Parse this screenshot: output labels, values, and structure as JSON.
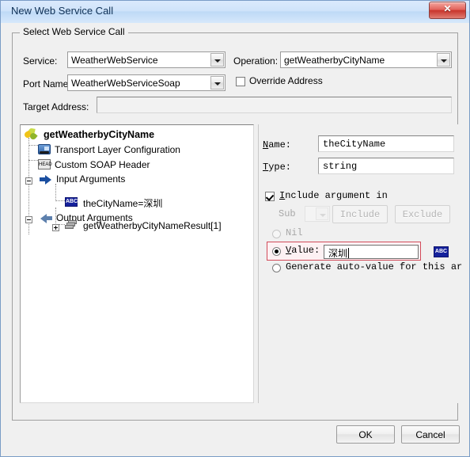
{
  "window": {
    "title": "New Web Service Call",
    "close_label": "✕",
    "close_icon": "close-icon"
  },
  "groupbox": {
    "title": "Select Web Service Call"
  },
  "form": {
    "service_label": "Service:",
    "service_value": "WeatherWebService",
    "operation_label": "Operation:",
    "operation_value": "getWeatherbyCityName",
    "port_name_label": "Port Name:",
    "port_name_value": "WeatherWebServiceSoap",
    "override_address_label": "Override Address",
    "override_address_checked": false,
    "target_address_label": "Target Address:",
    "target_address_value": "",
    "target_address_enabled": false
  },
  "tree": {
    "nodes": [
      {
        "label": "getWeatherbyCityName",
        "icon": "service-leaf-icon",
        "level": 0,
        "expander": "none",
        "bold": true
      },
      {
        "label": "Transport Layer Configuration",
        "icon": "transport-truck-icon",
        "level": 1,
        "expander": "none",
        "bold": false
      },
      {
        "label": "Custom SOAP Header",
        "icon": "soap-header-icon",
        "level": 1,
        "expander": "none",
        "bold": false
      },
      {
        "label": "Input Arguments",
        "icon": "arrow-right-icon",
        "level": 1,
        "expander": "minus",
        "bold": false
      },
      {
        "label": "theCityName=深圳",
        "icon": "abc-string-icon",
        "level": 2,
        "expander": "none",
        "bold": false
      },
      {
        "label": "Output Arguments",
        "icon": "arrow-left-icon",
        "level": 1,
        "expander": "minus",
        "bold": false
      },
      {
        "label": "getWeatherbyCityNameResult[1]",
        "icon": "array-stack-icon",
        "level": 2,
        "expander": "plus",
        "bold": false
      }
    ]
  },
  "details": {
    "name_label": "Name:",
    "name_mnemonic": "N",
    "name_value": "theCityName",
    "type_label": "Type:",
    "type_mnemonic": "T",
    "type_value": "string",
    "include_label": "Include argument in",
    "include_mnemonic": "I",
    "include_checked": true,
    "sub_label": "Sub",
    "sub_value": "",
    "include_button": "Include",
    "exclude_button": "Exclude",
    "nil_label": "Nil",
    "nil_selected": false,
    "value_label": "Value:",
    "value_mnemonic": "V",
    "value_selected": true,
    "value_text": "深圳",
    "abc_button_label": "ABC",
    "generate_label": "Generate auto-value for this ar",
    "generate_selected": false
  },
  "footer": {
    "ok_label": "OK",
    "cancel_label": "Cancel"
  },
  "colors": {
    "title_bar": "#cfe3fa",
    "accent_red": "#d24b5a",
    "icon_blue": "#15219c",
    "dialog_bg": "#f0f0f0"
  }
}
